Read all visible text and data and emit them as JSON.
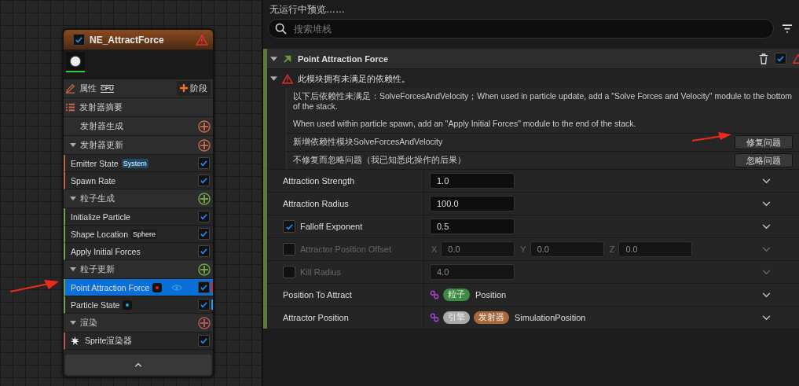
{
  "node": {
    "title": "NE_AttractForce",
    "checked": true,
    "props_label": "属性",
    "props_tag": "CPU",
    "stage_button": "阶段",
    "summary": "发射器摘要",
    "groups": [
      {
        "label": "发射器生成",
        "expanded": false,
        "color": "#c0664a"
      },
      {
        "label": "发射器更新",
        "expanded": true,
        "color": "#c0664a",
        "modules": [
          {
            "label": "Emitter State",
            "tag": "System",
            "kind": "text-tag",
            "checked": true,
            "selected": false
          },
          {
            "label": "Spawn Rate",
            "kind": "plain",
            "checked": true,
            "selected": false
          }
        ]
      },
      {
        "label": "粒子生成",
        "expanded": true,
        "color": "#6fa24a",
        "modules": [
          {
            "label": "Initialize Particle",
            "kind": "plain",
            "checked": true,
            "selected": false
          },
          {
            "label": "Shape Location",
            "tag": "Sphere",
            "kind": "text-tag",
            "checked": true,
            "selected": false
          },
          {
            "label": "Apply Initial Forces",
            "kind": "plain",
            "checked": true,
            "selected": false
          }
        ]
      },
      {
        "label": "粒子更新",
        "expanded": true,
        "color": "#6fa24a",
        "modules": [
          {
            "label": "Point Attraction Force",
            "kind": "dot-tag",
            "color": "#e02020",
            "eye": true,
            "checked": true,
            "selected": true
          },
          {
            "label": "Particle State",
            "kind": "dot-tag",
            "color": "#1ea0f0",
            "checked": true,
            "selected": false
          }
        ]
      },
      {
        "label": "渲染",
        "expanded": true,
        "color": "#b05858",
        "modules": [
          {
            "label": "Sprite渲染器",
            "kind": "renderer",
            "checked": true,
            "selected": false
          }
        ]
      }
    ]
  },
  "preview_text": "无运行中预览……",
  "search": {
    "placeholder": "搜索堆栈"
  },
  "module": {
    "title": "Point Attraction Force",
    "checked": true,
    "issue": {
      "title": "此模块拥有未满足的依赖性。",
      "expanded": true,
      "description": [
        "以下后依赖性未满足：SolveForcesAndVelocity；When used in particle update, add a \"Solve Forces and Velocity\" module to the bottom of the stack.",
        "When used within particle spawn, add an \"Apply Initial Forces\" module to the end of the stack."
      ],
      "fixes": [
        {
          "text": "新增依赖性模块SolveForcesAndVelocity",
          "button": "修复问题"
        },
        {
          "text": "不修复而忽略问题（我已知悉此操作的后果）",
          "button": "忽略问题"
        }
      ]
    },
    "params": [
      {
        "kind": "value",
        "label": "Attraction Strength",
        "value": "1.0"
      },
      {
        "kind": "value",
        "label": "Attraction Radius",
        "value": "100.0"
      },
      {
        "kind": "toggle-value",
        "label": "Falloff Exponent",
        "checked": true,
        "value": "0.5"
      },
      {
        "kind": "toggle-vector",
        "label": "Attractor Position Offset",
        "checked": false,
        "axes": [
          {
            "axis": "X",
            "value": "0.0"
          },
          {
            "axis": "Y",
            "value": "0.0"
          },
          {
            "axis": "Z",
            "value": "0.0"
          }
        ]
      },
      {
        "kind": "toggle-value",
        "label": "Kill Radius",
        "checked": false,
        "value": "4.0"
      },
      {
        "kind": "link",
        "label": "Position To Attract",
        "tags": [
          {
            "label": "粒子",
            "color": "#3f8a45"
          }
        ],
        "value": "Position"
      },
      {
        "kind": "link",
        "label": "Attractor Position",
        "tags": [
          {
            "label": "引擎",
            "color": "#a9a9a9"
          },
          {
            "label": "发射器",
            "color": "#a8683a"
          }
        ],
        "value": "SimulationPosition"
      }
    ]
  }
}
